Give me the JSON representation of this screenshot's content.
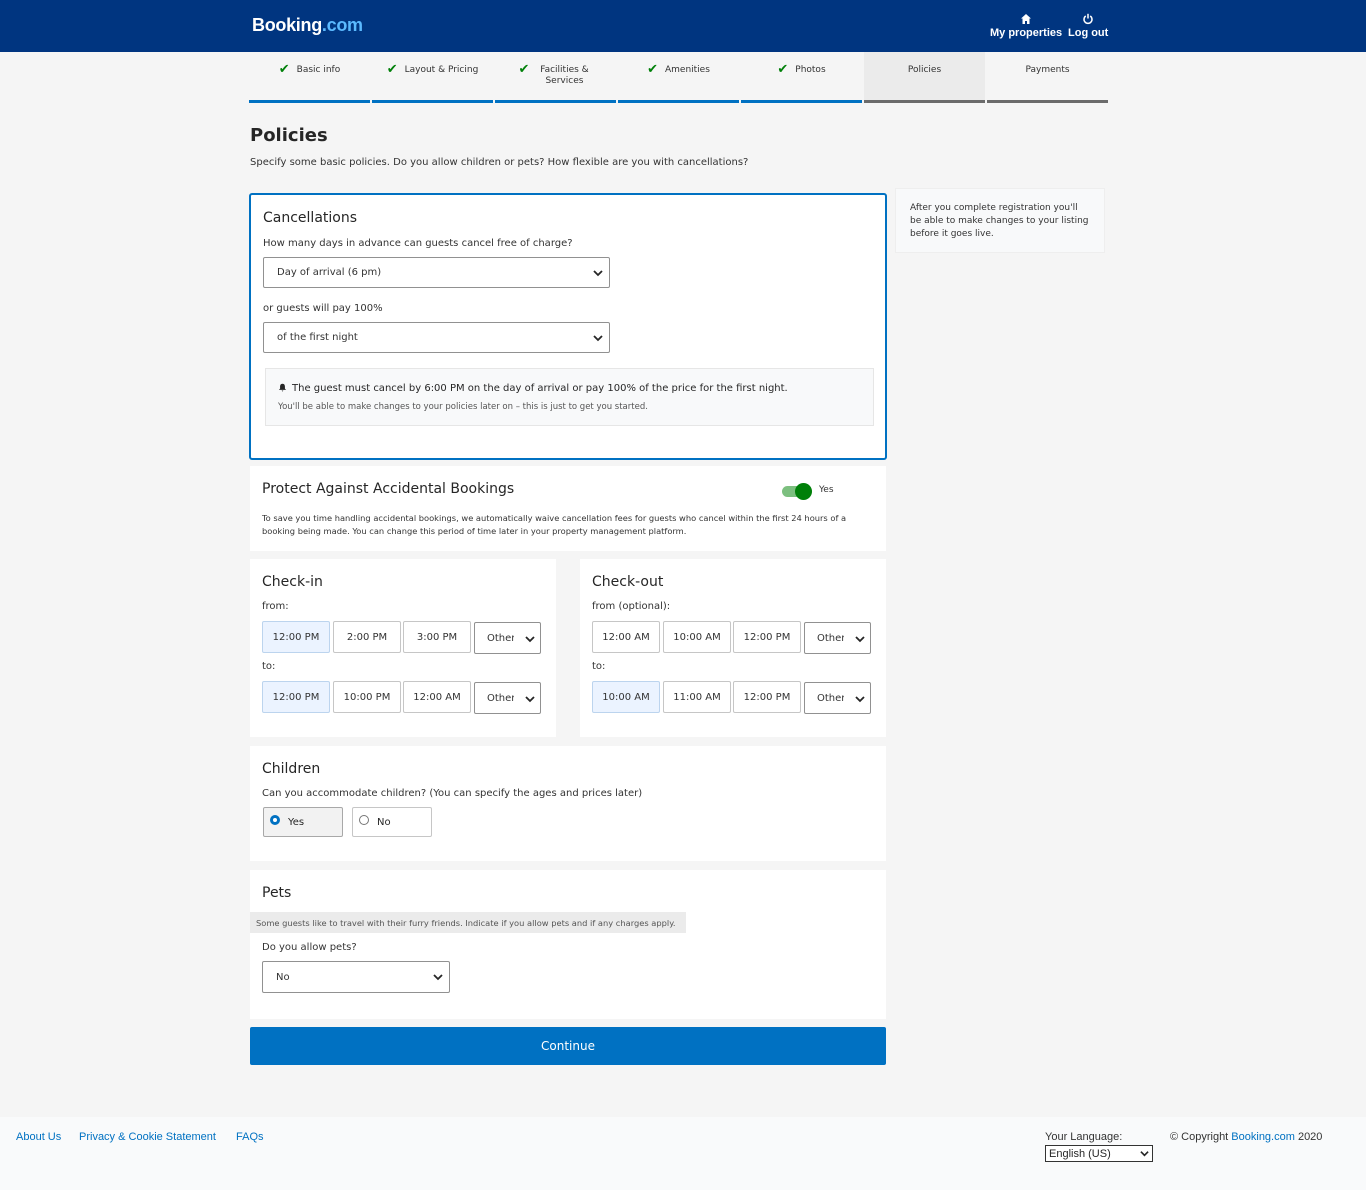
{
  "header": {
    "logo_main": "Booking",
    "logo_domain": ".com",
    "my_properties": "My properties",
    "log_out": "Log out"
  },
  "steps": [
    {
      "label": "Basic info",
      "done": true
    },
    {
      "label": "Layout & Pricing",
      "done": true
    },
    {
      "label": "Facilities & Services",
      "done": true
    },
    {
      "label": "Amenities",
      "done": true
    },
    {
      "label": "Photos",
      "done": true
    },
    {
      "label": "Policies",
      "active": true
    },
    {
      "label": "Payments"
    }
  ],
  "page": {
    "title": "Policies",
    "subtitle": "Specify some basic policies. Do you allow children or pets? How flexible are you with cancellations?"
  },
  "aside": {
    "text": "After you complete registration you'll be able to make changes to your listing before it goes live."
  },
  "cancellations": {
    "title": "Cancellations",
    "days_label": "How many days in advance can guests cancel free of charge?",
    "days_value": "Day of arrival (6 pm)",
    "pay_label": "or guests will pay 100%",
    "pay_value": "of the first night",
    "notice_main": "The guest must cancel by 6:00 PM on the day of arrival or pay 100% of the price for the first night.",
    "notice_sub": "You'll be able to make changes to your policies later on – this is just to get you started."
  },
  "protect": {
    "title": "Protect Against Accidental Bookings",
    "toggle_label": "Yes",
    "description": "To save you time handling accidental bookings, we automatically waive cancellation fees for guests who cancel within the first 24 hours of a booking being made. You can change this period of time later in your property management platform."
  },
  "checkin": {
    "title": "Check-in",
    "from_label": "from:",
    "from_options": [
      "12:00 PM",
      "2:00 PM",
      "3:00 PM"
    ],
    "from_other": "Other",
    "to_label": "to:",
    "to_options": [
      "12:00 PM",
      "10:00 PM",
      "12:00 AM"
    ],
    "to_other": "Other"
  },
  "checkout": {
    "title": "Check-out",
    "from_label": "from (optional):",
    "from_options": [
      "12:00 AM",
      "10:00 AM",
      "12:00 PM"
    ],
    "from_other": "Other",
    "to_label": "to:",
    "to_options": [
      "10:00 AM",
      "11:00 AM",
      "12:00 PM"
    ],
    "to_other": "Other"
  },
  "children": {
    "title": "Children",
    "question": "Can you accommodate children? (You can specify the ages and prices later)",
    "yes": "Yes",
    "no": "No"
  },
  "pets": {
    "title": "Pets",
    "hint": "Some guests like to travel with their furry friends. Indicate if you allow pets and if any charges apply.",
    "question": "Do you allow pets?",
    "value": "No"
  },
  "continue_label": "Continue",
  "footer": {
    "about": "About Us",
    "privacy": "Privacy & Cookie Statement",
    "faqs": "FAQs",
    "language_label": "Your Language:",
    "language_value": "English (US)",
    "copyright_prefix": "© Copyright ",
    "copyright_link": "Booking.com",
    "copyright_year": " 2020"
  },
  "colors": {
    "header_bg": "#003580",
    "accent": "#0071c2",
    "success": "#008009"
  }
}
